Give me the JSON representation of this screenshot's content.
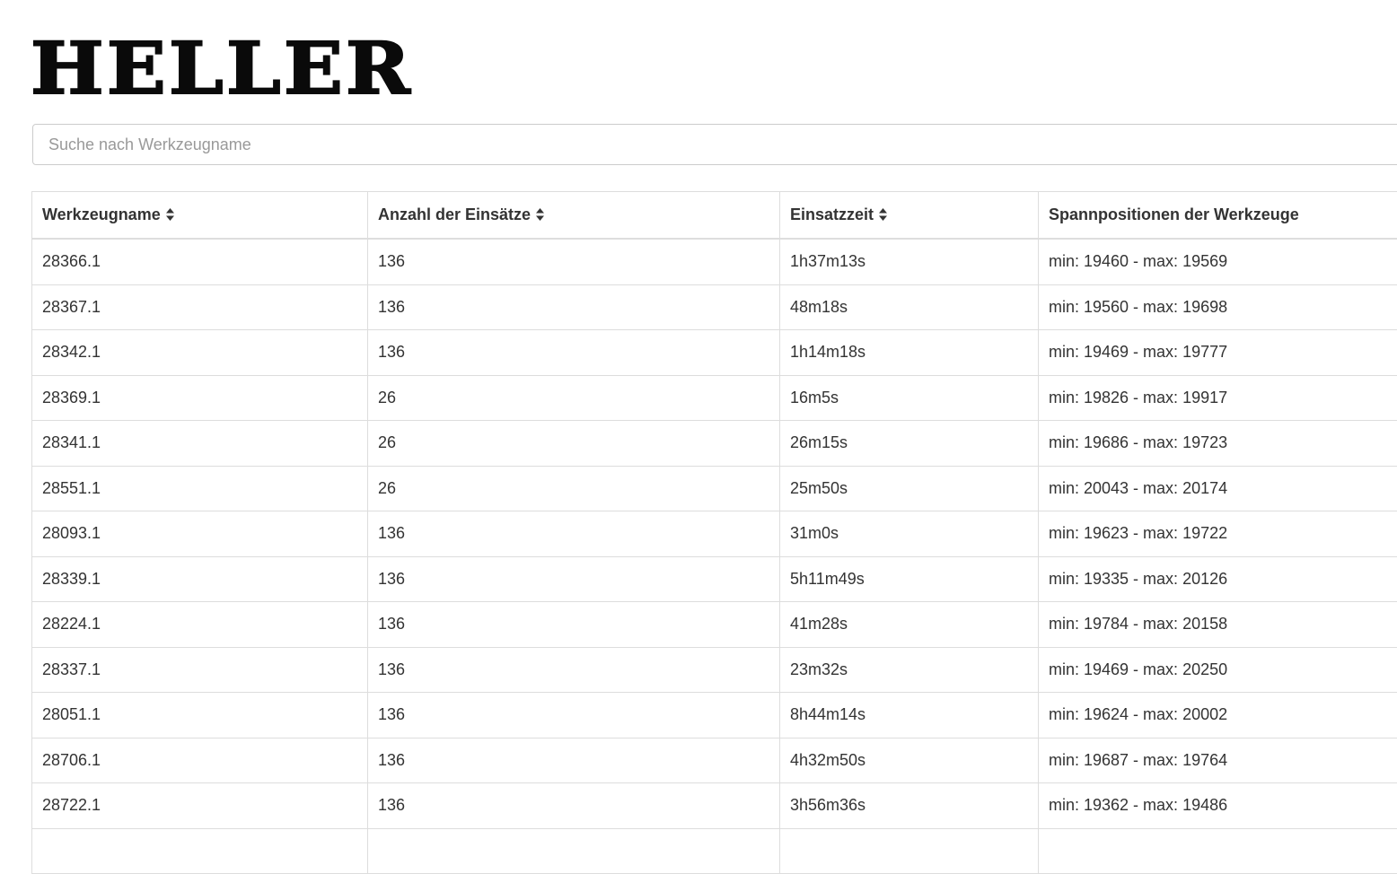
{
  "logo": {
    "text": "HELLER"
  },
  "search": {
    "placeholder": "Suche nach Werkzeugname",
    "value": ""
  },
  "table": {
    "columns": [
      {
        "label": "Werkzeugname",
        "sortable": true
      },
      {
        "label": "Anzahl der Einsätze",
        "sortable": true
      },
      {
        "label": "Einsatzzeit",
        "sortable": true
      },
      {
        "label": "Spannpositionen der Werkzeuge",
        "sortable": false
      }
    ],
    "rows": [
      [
        "28366.1",
        "136",
        "1h37m13s",
        "min: 19460 - max: 19569"
      ],
      [
        "28367.1",
        "136",
        "48m18s",
        "min: 19560 - max: 19698"
      ],
      [
        "28342.1",
        "136",
        "1h14m18s",
        "min: 19469 - max: 19777"
      ],
      [
        "28369.1",
        "26",
        "16m5s",
        "min: 19826 - max: 19917"
      ],
      [
        "28341.1",
        "26",
        "26m15s",
        "min: 19686 - max: 19723"
      ],
      [
        "28551.1",
        "26",
        "25m50s",
        "min: 20043 - max: 20174"
      ],
      [
        "28093.1",
        "136",
        "31m0s",
        "min: 19623 - max: 19722"
      ],
      [
        "28339.1",
        "136",
        "5h11m49s",
        "min: 19335 - max: 20126"
      ],
      [
        "28224.1",
        "136",
        "41m28s",
        "min: 19784 - max: 20158"
      ],
      [
        "28337.1",
        "136",
        "23m32s",
        "min: 19469 - max: 20250"
      ],
      [
        "28051.1",
        "136",
        "8h44m14s",
        "min: 19624 - max: 20002"
      ],
      [
        "28706.1",
        "136",
        "4h32m50s",
        "min: 19687 - max: 19764"
      ],
      [
        "28722.1",
        "136",
        "3h56m36s",
        "min: 19362 - max: 19486"
      ],
      [
        "",
        "",
        "",
        ""
      ]
    ]
  }
}
